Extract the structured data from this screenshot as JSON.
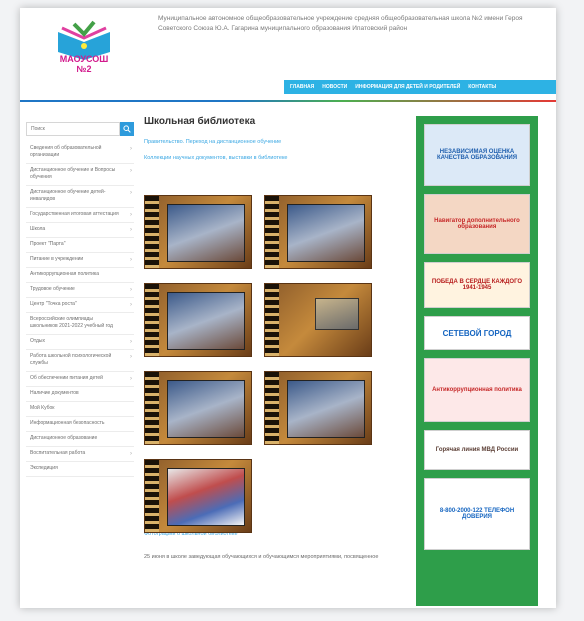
{
  "header": {
    "logo_text": "МАОУСОШ №2",
    "school_name": "Муниципальное автономное общеобразовательное учреждение средняя общеобразовательная школа №2 имени Героя Советского Союза Ю.А. Гагарина муниципального образования Ипатовский район"
  },
  "topnav": [
    "ГЛАВНАЯ",
    "НОВОСТИ",
    "ИНФОРМАЦИЯ ДЛЯ ДЕТЕЙ И РОДИТЕЛЕЙ",
    "КОНТАКТЫ"
  ],
  "search": {
    "placeholder": "Поиск"
  },
  "sidebar": [
    {
      "label": "Сведения об образовательной организации",
      "chev": true
    },
    {
      "label": "Дистанционное обучение и Вопросы обучения",
      "chev": true
    },
    {
      "label": "Дистанционное обучение детей-инвалидов",
      "chev": true
    },
    {
      "label": "Государственная итоговая аттестация",
      "chev": true
    },
    {
      "label": "Школа",
      "chev": true
    },
    {
      "label": "Проект \"Парта\"",
      "chev": false
    },
    {
      "label": "Питание в учреждении",
      "chev": true
    },
    {
      "label": "Антикоррупционная политика",
      "chev": false
    },
    {
      "label": "Трудовое обучение",
      "chev": true
    },
    {
      "label": "Центр \"Точка роста\"",
      "chev": true
    },
    {
      "label": "Всероссийские олимпиады школьников 2021-2022 учебный год",
      "chev": false
    },
    {
      "label": "Отдых",
      "chev": true
    },
    {
      "label": "Работа школьной психологической службы",
      "chev": true
    },
    {
      "label": "Об обеспечении питания детей",
      "chev": true
    },
    {
      "label": "Наличие документов",
      "chev": false
    },
    {
      "label": "Мой Кубок",
      "chev": false
    },
    {
      "label": "Информационная безопасность",
      "chev": false
    },
    {
      "label": "Дистанционное образование",
      "chev": false
    },
    {
      "label": "Воспитательная работа",
      "chev": true
    },
    {
      "label": "Экспедиция",
      "chev": false
    }
  ],
  "main": {
    "title": "Школьная библиотека",
    "link1": "Правительство. Переход на дистанционное обучение",
    "link2": "Коллекции научных документов, выставки в библиотеке",
    "bottom_link": "Фотографии о школьной библиотеке",
    "bottom_text": "25 июня в школе заведующая обучающихся и обучающимся мероприятиями, посвященное"
  },
  "banners": [
    {
      "text": "НЕЗАВИСИМАЯ ОЦЕНКА КАЧЕСТВА ОБРАЗОВАНИЯ",
      "color": "#1f5fae"
    },
    {
      "text": "Навигатор дополнительного образования",
      "color": "#c62828"
    },
    {
      "text": "ПОБЕДА В СЕРДЦЕ КАЖДОГО 1941-1945",
      "color": "#b71c1c"
    },
    {
      "text": "СЕТЕВОЙ ГОРОД",
      "color": "#1565c0"
    },
    {
      "text": "Антикоррупционная политика",
      "color": "#c62828"
    },
    {
      "text": "Горячая линия МВД России",
      "color": "#5d4037"
    },
    {
      "text": "8-800-2000-122 ТЕЛЕФОН ДОВЕРИЯ",
      "color": "#1565c0"
    }
  ]
}
